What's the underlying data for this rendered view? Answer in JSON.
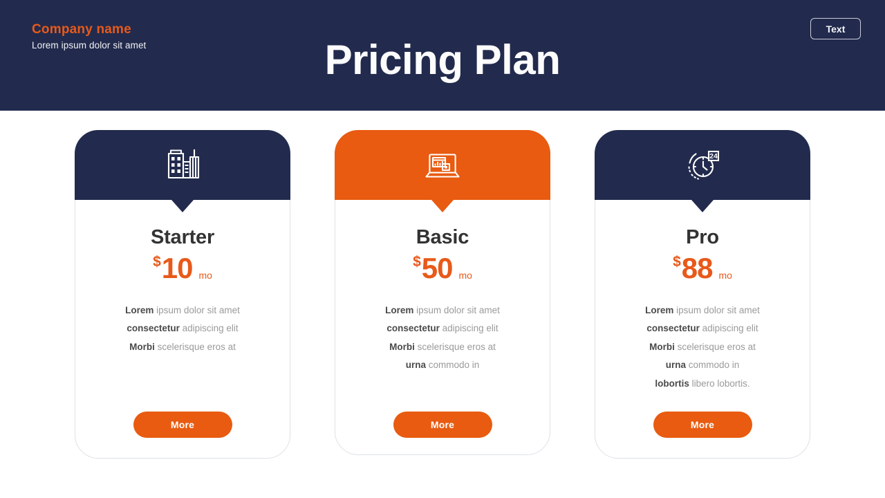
{
  "header": {
    "brand_name": "Company  name",
    "brand_tagline": "Lorem ipsum dolor sit amet",
    "title": "Pricing Plan",
    "text_button_label": "Text",
    "background_color": "#222B4D",
    "accent_color": "#E85B10"
  },
  "plans": [
    {
      "id": "starter",
      "name": "Starter",
      "icon": "office-building-icon",
      "header_color": "#222B4D",
      "currency": "$",
      "amount": "10",
      "period": "mo",
      "features": [
        {
          "strong": "Lorem",
          "rest": " ipsum dolor sit amet"
        },
        {
          "strong": "consectetur",
          "rest": " adipiscing elit"
        },
        {
          "strong": "Morbi",
          "rest": " scelerisque eros at"
        }
      ],
      "cta_label": "More"
    },
    {
      "id": "basic",
      "name": "Basic",
      "icon": "laptop-chart-icon",
      "header_color": "#E85B10",
      "currency": "$",
      "amount": "50",
      "period": "mo",
      "features": [
        {
          "strong": "Lorem",
          "rest": " ipsum dolor sit amet"
        },
        {
          "strong": "consectetur",
          "rest": " adipiscing elit"
        },
        {
          "strong": "Morbi",
          "rest": " scelerisque eros at"
        },
        {
          "strong": "urna",
          "rest": " commodo in"
        }
      ],
      "cta_label": "More"
    },
    {
      "id": "pro",
      "name": "Pro",
      "icon": "clock-24h-icon",
      "header_color": "#222B4D",
      "currency": "$",
      "amount": "88",
      "period": "mo",
      "features": [
        {
          "strong": "Lorem",
          "rest": " ipsum dolor sit amet"
        },
        {
          "strong": "consectetur",
          "rest": " adipiscing elit"
        },
        {
          "strong": "Morbi",
          "rest": " scelerisque eros at"
        },
        {
          "strong": "urna",
          "rest": " commodo in"
        },
        {
          "strong": "lobortis",
          "rest": " libero lobortis."
        }
      ],
      "cta_label": "More"
    }
  ]
}
